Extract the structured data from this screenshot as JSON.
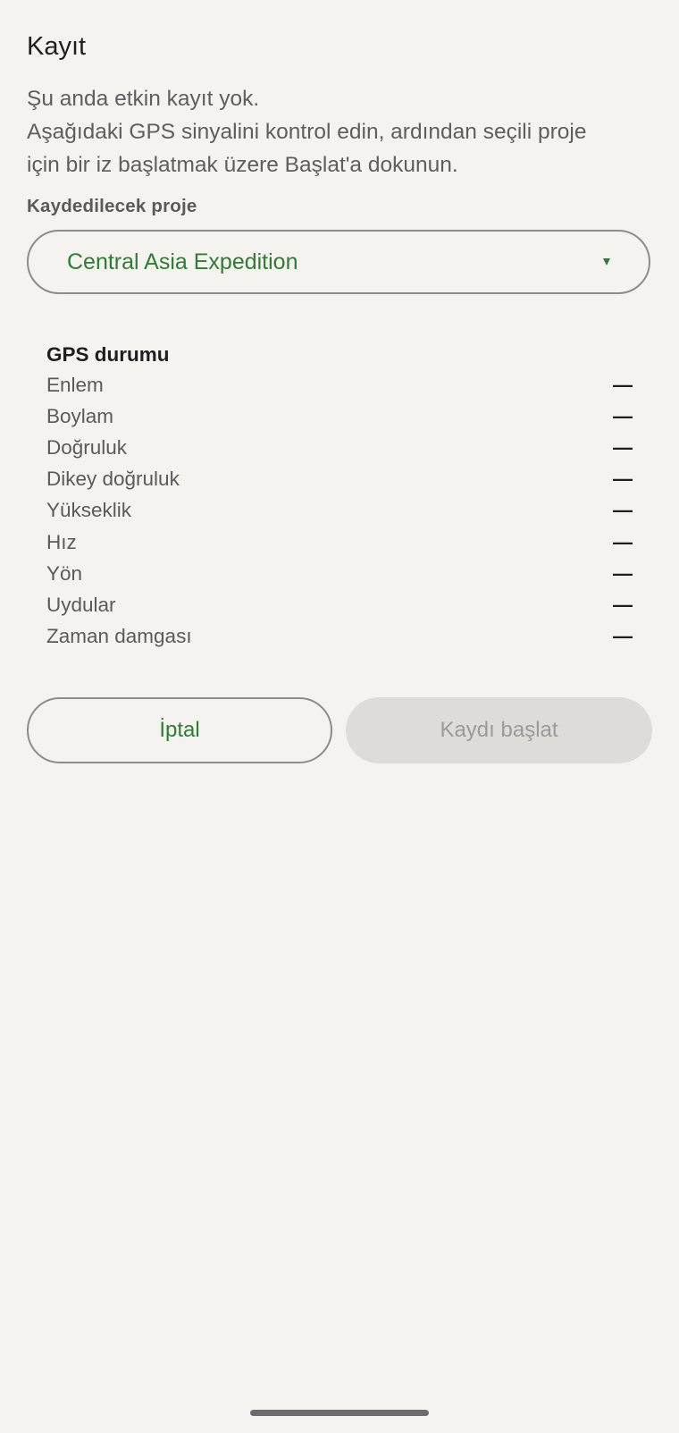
{
  "header": {
    "title": "Kayıt"
  },
  "description": {
    "lines": [
      "Şu anda etkin kayıt yok.",
      "Aşağıdaki GPS sinyalini kontrol edin, ardından seçili proje",
      "için bir iz başlatmak üzere Başlat'a dokunun."
    ]
  },
  "project": {
    "label": "Kaydedilecek proje",
    "selected": "Central Asia Expedition",
    "dropdown_icon": "caret-down-icon"
  },
  "gps": {
    "title": "GPS durumu",
    "rows": [
      {
        "label": "Enlem",
        "value": "—"
      },
      {
        "label": "Boylam",
        "value": "—"
      },
      {
        "label": "Doğruluk",
        "value": "—"
      },
      {
        "label": "Dikey doğruluk",
        "value": "—"
      },
      {
        "label": "Yükseklik",
        "value": "—"
      },
      {
        "label": "Hız",
        "value": "—"
      },
      {
        "label": "Yön",
        "value": "—"
      },
      {
        "label": "Uydular",
        "value": "—"
      },
      {
        "label": "Zaman damgası",
        "value": "—"
      }
    ]
  },
  "actions": {
    "cancel_label": "İptal",
    "start_label": "Kaydı başlat",
    "start_enabled": false
  },
  "colors": {
    "background": "#f4f3f0",
    "accent": "#2e7d32",
    "outline": "#8f8c86",
    "disabled_fill": "#dedcd9",
    "disabled_text": "#9a9a9a"
  }
}
